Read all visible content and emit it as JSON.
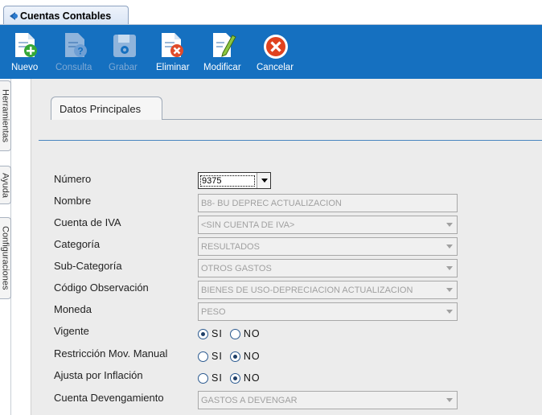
{
  "window": {
    "tab_title": "Cuentas Contables"
  },
  "toolbar": {
    "buttons": [
      {
        "label": "Nuevo",
        "icon": "new-document-plus-icon",
        "enabled": true
      },
      {
        "label": "Consulta",
        "icon": "document-question-icon",
        "enabled": false
      },
      {
        "label": "Grabar",
        "icon": "save-disk-icon",
        "enabled": false
      },
      {
        "label": "Eliminar",
        "icon": "document-delete-icon",
        "enabled": true
      },
      {
        "label": "Modificar",
        "icon": "document-edit-pencil-icon",
        "enabled": true
      },
      {
        "label": "Cancelar",
        "icon": "cancel-circle-icon",
        "enabled": true
      }
    ]
  },
  "side_tabs": [
    "Herramientas",
    "Ayuda",
    "Configuraciones"
  ],
  "panel": {
    "tab_label": "Datos Principales"
  },
  "form": {
    "numero": {
      "label": "Número",
      "value": "9375"
    },
    "nombre": {
      "label": "Nombre",
      "value": "B8- BU DEPREC ACTUALIZACION"
    },
    "cuenta_iva": {
      "label": "Cuenta de IVA",
      "value": "<SIN CUENTA DE IVA>"
    },
    "categoria": {
      "label": "Categoría",
      "value": "RESULTADOS"
    },
    "sub_categoria": {
      "label": "Sub-Categoría",
      "value": "OTROS GASTOS"
    },
    "codigo_observacion": {
      "label": "Código Observación",
      "value": "BIENES DE USO-DEPRECIACION ACTUALIZACION"
    },
    "moneda": {
      "label": "Moneda",
      "value": "PESO"
    },
    "vigente": {
      "label": "Vigente",
      "options": [
        "SI",
        "NO"
      ],
      "selected": "SI"
    },
    "restriccion": {
      "label": "Restricción Mov. Manual",
      "options": [
        "SI",
        "NO"
      ],
      "selected": "NO"
    },
    "ajusta_inflacion": {
      "label": "Ajusta por Inflación",
      "options": [
        "SI",
        "NO"
      ],
      "selected": "NO"
    },
    "cuenta_devengamiento": {
      "label": "Cuenta Devengamiento",
      "value": "GASTOS A DEVENGAR"
    }
  },
  "colors": {
    "toolbar_bg": "#1570c0",
    "panel_bg": "#ececec",
    "accent_line": "#4a86c0"
  }
}
